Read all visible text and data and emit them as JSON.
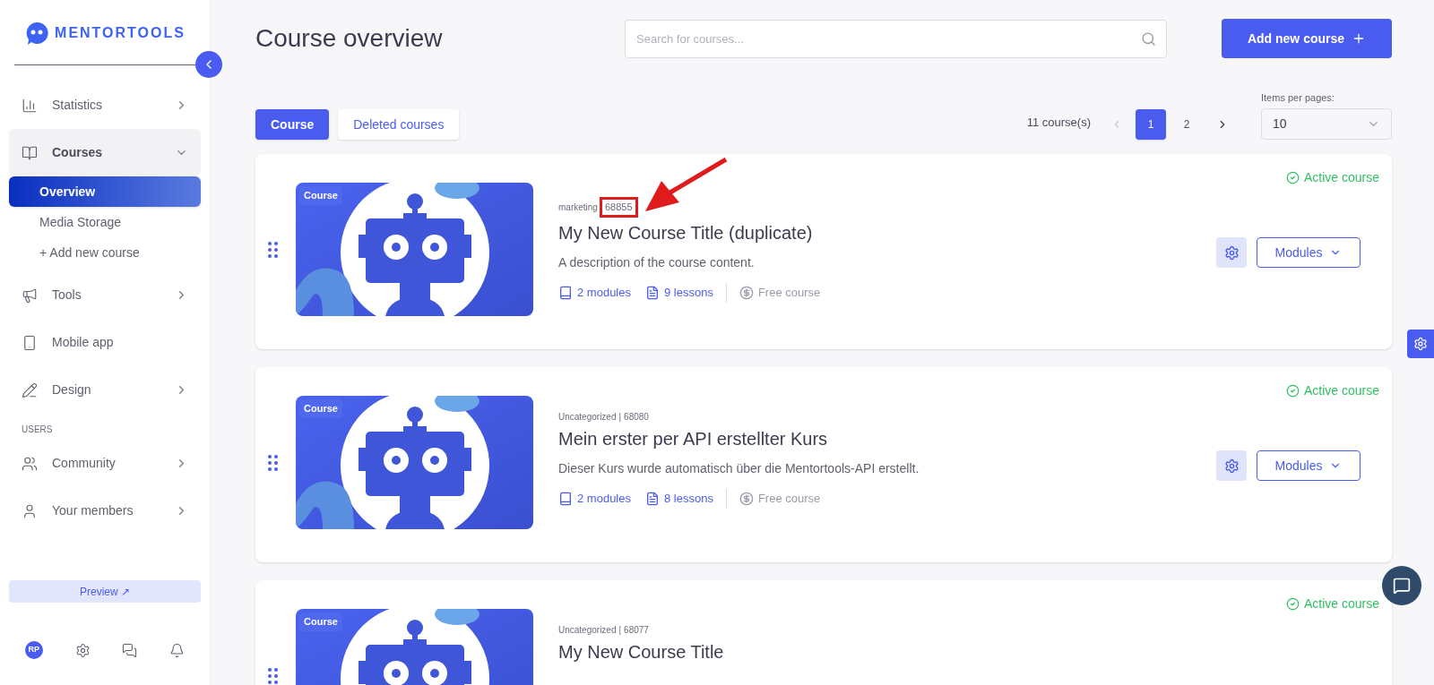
{
  "sidebar": {
    "logo": "MENTORTOOLS",
    "items": [
      {
        "kind": "item",
        "label": "Statistics",
        "expanded": false,
        "has_arrow": true
      },
      {
        "kind": "item",
        "label": "Courses",
        "expanded": true,
        "has_arrow": true,
        "children": [
          {
            "label": "Overview",
            "selected": true
          },
          {
            "label": "Media Storage",
            "selected": false
          },
          {
            "label": "+ Add new course",
            "selected": false
          }
        ]
      },
      {
        "kind": "item",
        "label": "Tools",
        "expanded": false,
        "has_arrow": true
      },
      {
        "kind": "item",
        "label": "Mobile app",
        "expanded": false,
        "has_arrow": false
      },
      {
        "kind": "item",
        "label": "Design",
        "expanded": false,
        "has_arrow": true
      },
      {
        "kind": "section",
        "label": "USERS"
      },
      {
        "kind": "item",
        "label": "Community",
        "expanded": false,
        "has_arrow": true
      },
      {
        "kind": "item",
        "label": "Your members",
        "expanded": false,
        "has_arrow": true
      }
    ],
    "preview": "Preview ↗",
    "avatar": "RP"
  },
  "header": {
    "title": "Course overview",
    "search": {
      "placeholder": "Search for courses..."
    },
    "add_button": "Add new course"
  },
  "tabs": [
    {
      "label": "Course",
      "selected": true
    },
    {
      "label": "Deleted courses",
      "selected": false
    }
  ],
  "pagination": {
    "count": "11 course(s)",
    "prev_disabled": true,
    "pages": [
      {
        "label": "1",
        "selected": true
      },
      {
        "label": "2",
        "selected": false
      }
    ],
    "items_per_page_label": "Items per pages:",
    "items_per_page": "10"
  },
  "courses": [
    {
      "badge": "Course",
      "category": "marketing",
      "id": "68855",
      "highlighted": true,
      "title": "My New Course Title (duplicate)",
      "description": "A description of the course content.",
      "modules": "2 modules",
      "lessons": "9 lessons",
      "price": "Free course",
      "status": "Active course",
      "button": "Modules"
    },
    {
      "badge": "Course",
      "category": "Uncategorized",
      "separator": "|",
      "id": "68080",
      "highlighted": false,
      "title": "Mein erster per API erstellter Kurs",
      "description": "Dieser Kurs wurde automatisch über die Mentortools-API erstellt.",
      "modules": "2 modules",
      "lessons": "8 lessons",
      "price": "Free course",
      "status": "Active course",
      "button": "Modules"
    },
    {
      "badge": "Course",
      "category": "Uncategorized",
      "separator": "|",
      "id": "68077",
      "highlighted": false,
      "title": "My New Course Title",
      "status": "Active course"
    }
  ]
}
